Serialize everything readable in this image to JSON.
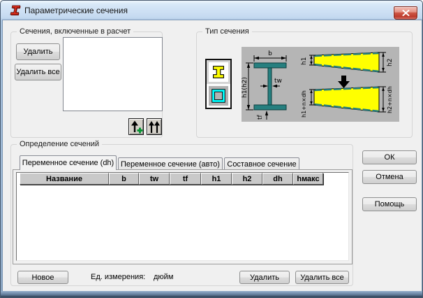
{
  "window": {
    "title": "Параметрические сечения"
  },
  "colors": {
    "titlebar_blue": "#c4d9f0",
    "close_red": "#bd3a2c",
    "dialog_bg": "#f0f0f0",
    "beam_teal": "#267f7f",
    "beam_yellow": "#ffff00",
    "box_cyan": "#00ffff",
    "header_gray": "#c9c9c9"
  },
  "sections_group": {
    "title": "Сечения, включенные в расчет",
    "delete_button": "Удалить",
    "delete_all_button": "Удалить все"
  },
  "type_group": {
    "title": "Тип сечения",
    "diagram": {
      "b": "b",
      "h": "h1(h2)",
      "tw": "tw",
      "tf": "tf",
      "h1": "h1",
      "h2": "h2",
      "h1n": "h1+n×dh",
      "h2n": "h2+n×dh"
    }
  },
  "definition_group": {
    "title": "Определение сечений",
    "tabs": [
      {
        "label": "Переменное сечение (dh)"
      },
      {
        "label": "Переменное сечение (авто)"
      },
      {
        "label": "Составное сечение"
      }
    ],
    "table": {
      "columns": [
        "Название",
        "b",
        "tw",
        "tf",
        "h1",
        "h2",
        "dh",
        "hмакс"
      ],
      "rows": []
    },
    "new_button": "Новое",
    "units_label": "Ед. измерения:",
    "units_value": "дюйм",
    "delete_button": "Удалить",
    "delete_all_button": "Удалить все"
  },
  "action_buttons": {
    "ok": "ОК",
    "cancel": "Отмена",
    "help": "Помощь"
  }
}
